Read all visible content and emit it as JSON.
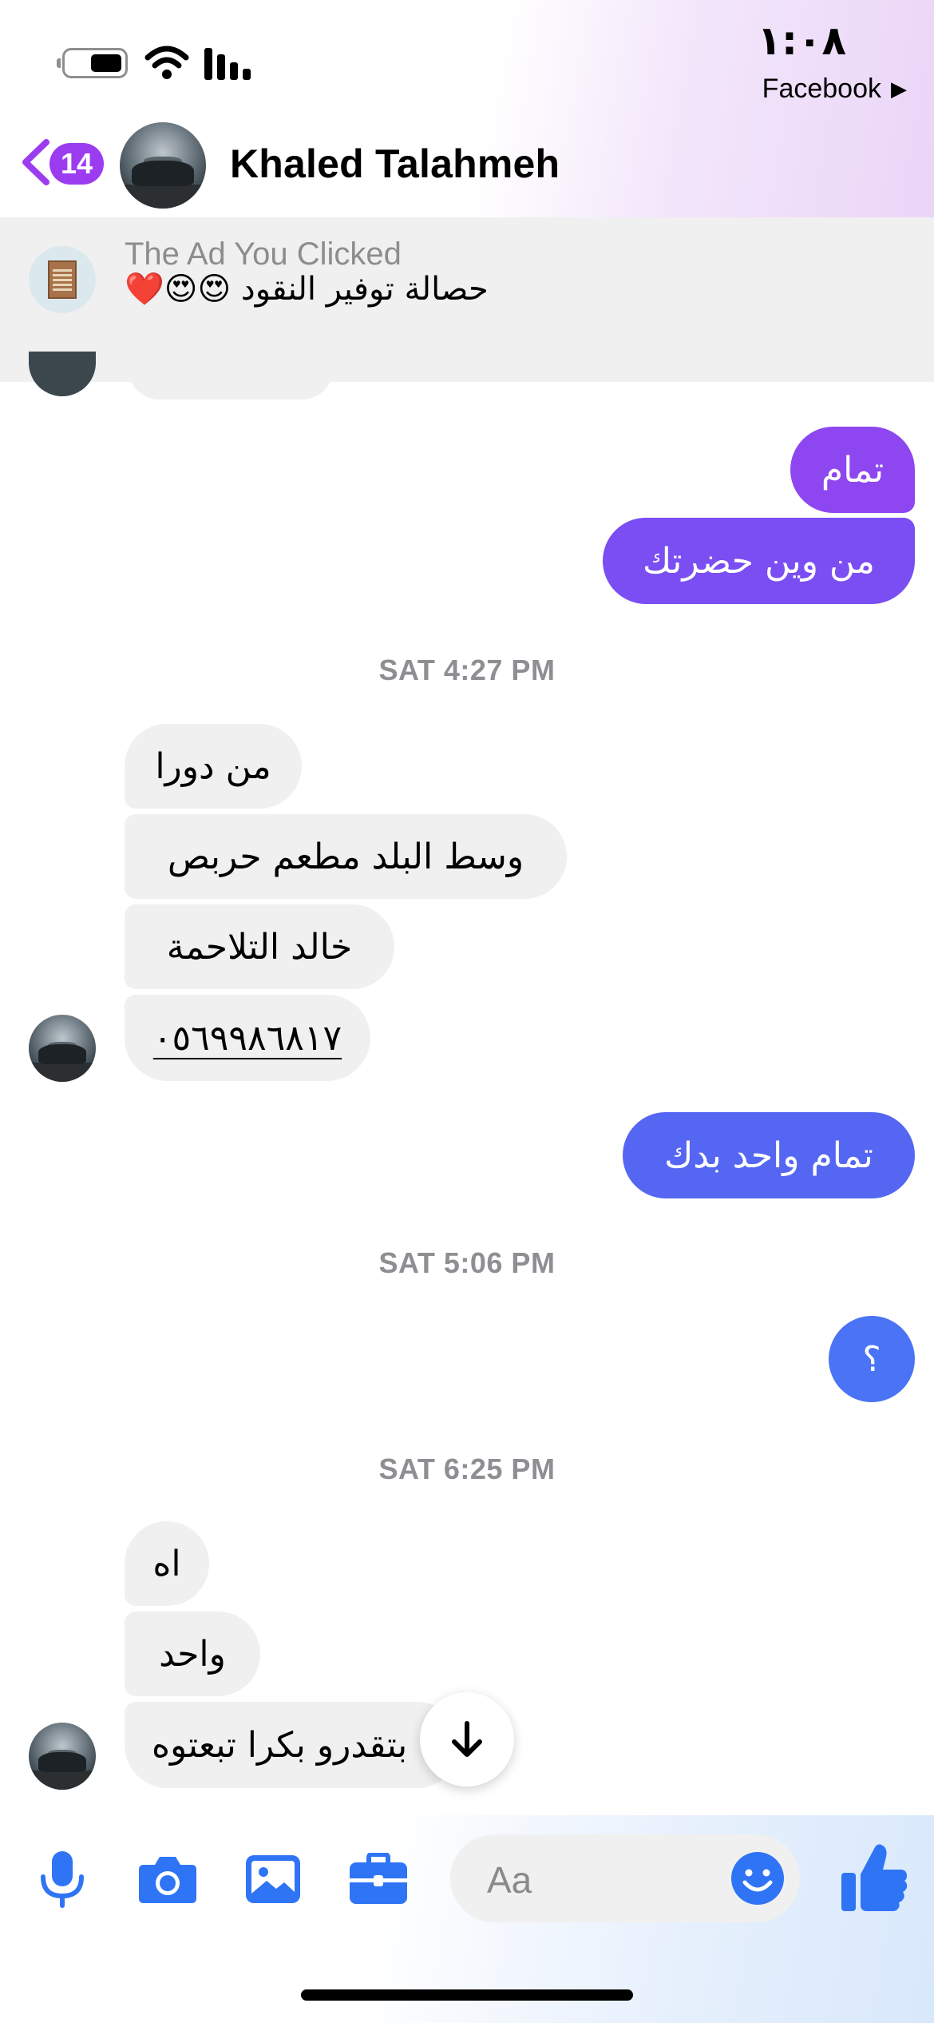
{
  "status_bar": {
    "time": "١:٠٨",
    "back_app_label": "Facebook",
    "back_app_glyph": "▶"
  },
  "header": {
    "unread_count": "14",
    "contact_name": "Khaled Talahmeh"
  },
  "ad_banner": {
    "label": "The Ad You Clicked",
    "title": "حصالة توفير النقود 😍😍❤️"
  },
  "messages": [
    {
      "type": "out",
      "text": "تمام",
      "color": "#8e47f0"
    },
    {
      "type": "out",
      "text": "من وين حضرتك",
      "color": "#7a4ef2"
    },
    {
      "type": "time",
      "text": "SAT 4:27 PM"
    },
    {
      "type": "in",
      "text": "من دورا"
    },
    {
      "type": "in",
      "text": "وسط البلد مطعم حربص"
    },
    {
      "type": "in",
      "text": "خالد التلاحمة"
    },
    {
      "type": "in",
      "text": "٠٥٦٩٩٨٦٨١٧"
    },
    {
      "type": "out",
      "text": "تمام واحد بدك",
      "color": "#5566f3"
    },
    {
      "type": "time",
      "text": "SAT 5:06 PM"
    },
    {
      "type": "out",
      "text": "؟",
      "color": "#4a73f5"
    },
    {
      "type": "time",
      "text": "SAT 6:25 PM"
    },
    {
      "type": "in",
      "text": "اه"
    },
    {
      "type": "in",
      "text": "واحد"
    },
    {
      "type": "in",
      "text": "بتقدرو بكرا تبعتوه"
    }
  ],
  "composer": {
    "placeholder": "Aa",
    "icons": [
      "microphone-icon",
      "camera-icon",
      "gallery-icon",
      "briefcase-icon",
      "emoji-icon",
      "thumbs-up-icon"
    ],
    "accent_color": "#2f74f5"
  },
  "colors": {
    "incoming_bubble": "#f0f0f0",
    "badge": "#9b3cf0",
    "back_chevron": "#9b3cf0"
  }
}
